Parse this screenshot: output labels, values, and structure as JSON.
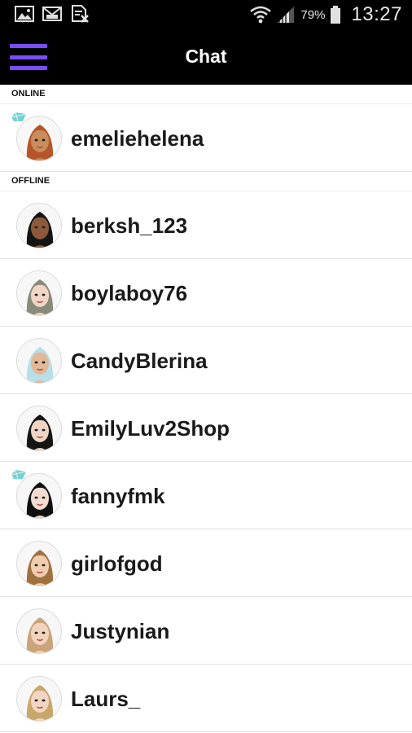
{
  "status_bar": {
    "battery_percent": "79%",
    "time": "13:27"
  },
  "app_bar": {
    "title": "Chat"
  },
  "sections": {
    "online_label": "ONLINE",
    "offline_label": "OFFLINE"
  },
  "online_users": [
    {
      "name": "emeliehelena",
      "vip": true,
      "hair": "#b5562a",
      "skin": "#c98c5c"
    }
  ],
  "offline_users": [
    {
      "name": "berksh_123",
      "vip": false,
      "hair": "#141414",
      "skin": "#8a5a3a"
    },
    {
      "name": "boylaboy76",
      "vip": false,
      "hair": "#8a8a7a",
      "skin": "#f1d6c8"
    },
    {
      "name": "CandyBlerina",
      "vip": false,
      "hair": "#b8dfe8",
      "skin": "#e2b896"
    },
    {
      "name": "EmilyLuv2Shop",
      "vip": false,
      "hair": "#151515",
      "skin": "#efd4c4"
    },
    {
      "name": "fannyfmk",
      "vip": true,
      "hair": "#0f0f0f",
      "skin": "#f3dccf"
    },
    {
      "name": "girlofgod",
      "vip": false,
      "hair": "#a0713f",
      "skin": "#f0cdae"
    },
    {
      "name": "Justynian",
      "vip": false,
      "hair": "#c9a47a",
      "skin": "#f2d3be"
    },
    {
      "name": "Laurs_",
      "vip": false,
      "hair": "#c9a76a",
      "skin": "#f2d6c2"
    }
  ],
  "colors": {
    "menu_accent": "#7b4cff",
    "vip_badge": "#5ec9c9",
    "bar_background": "#000000"
  },
  "icons": {
    "status_left": [
      "gallery-icon",
      "mail-icon",
      "file-x-icon"
    ],
    "status_right": [
      "wifi-icon",
      "signal-icon",
      "battery-icon"
    ],
    "menu": "hamburger-menu-icon",
    "vip": "vip-gem-icon"
  }
}
